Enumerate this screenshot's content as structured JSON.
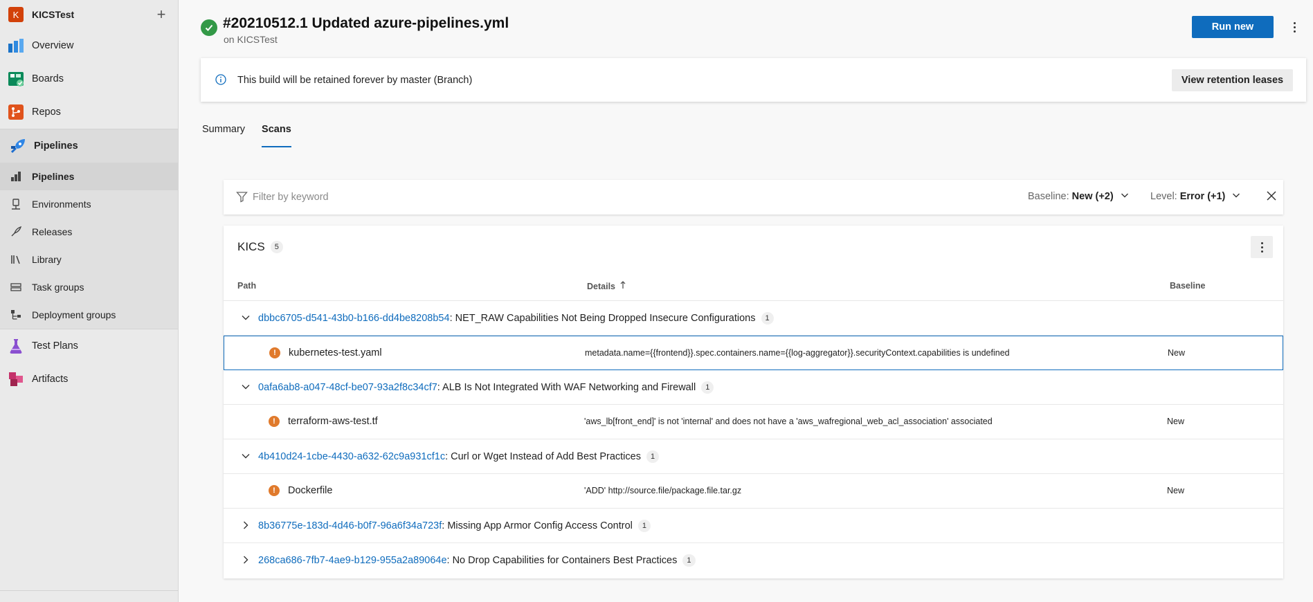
{
  "project": {
    "initial": "K",
    "name": "KICSTest"
  },
  "nav": {
    "overview": "Overview",
    "boards": "Boards",
    "repos": "Repos",
    "pipelines": "Pipelines",
    "sub": [
      "Pipelines",
      "Environments",
      "Releases",
      "Library",
      "Task groups",
      "Deployment groups"
    ],
    "test_plans": "Test Plans",
    "artifacts": "Artifacts"
  },
  "header": {
    "title": "#20210512.1 Updated azure-pipelines.yml",
    "subtitle": "on KICSTest",
    "run_new": "Run new"
  },
  "banner": {
    "text": "This build will be retained forever by master (Branch)",
    "button": "View retention leases"
  },
  "tabs": {
    "summary": "Summary",
    "scans": "Scans"
  },
  "filter": {
    "placeholder": "Filter by keyword",
    "baseline_label": "Baseline:",
    "baseline_value": "New (+2)",
    "level_label": "Level:",
    "level_value": "Error (+1)"
  },
  "results": {
    "tool": "KICS",
    "count": "5",
    "columns": {
      "path": "Path",
      "details": "Details",
      "baseline": "Baseline"
    },
    "groups": [
      {
        "id": "dbbc6705-d541-43b0-b166-dd4be8208b54",
        "title": ": NET_RAW Capabilities Not Being Dropped Insecure Configurations",
        "count": "1",
        "expanded": true,
        "finding": {
          "file": "kubernetes-test.yaml",
          "detail": "metadata.name={{frontend}}.spec.containers.name={{log-aggregator}}.securityContext.capabilities is undefined",
          "baseline": "New"
        }
      },
      {
        "id": "0afa6ab8-a047-48cf-be07-93a2f8c34cf7",
        "title": ": ALB Is Not Integrated With WAF Networking and Firewall",
        "count": "1",
        "expanded": true,
        "finding": {
          "file": "terraform-aws-test.tf",
          "detail": "'aws_lb[front_end]' is not 'internal' and does not have a 'aws_wafregional_web_acl_association' associated",
          "baseline": "New"
        }
      },
      {
        "id": "4b410d24-1cbe-4430-a632-62c9a931cf1c",
        "title": ": Curl or Wget Instead of Add Best Practices",
        "count": "1",
        "expanded": true,
        "finding": {
          "file": "Dockerfile",
          "detail": "'ADD' http://source.file/package.file.tar.gz",
          "baseline": "New"
        }
      },
      {
        "id": "8b36775e-183d-4d46-b0f7-96a6f34a723f",
        "title": ": Missing App Armor Config Access Control",
        "count": "1",
        "expanded": false
      },
      {
        "id": "268ca686-7fb7-4ae9-b129-955a2a89064e",
        "title": ": No Drop Capabilities for Containers Best Practices",
        "count": "1",
        "expanded": false
      }
    ]
  },
  "colors": {
    "accent": "#0f6cbd",
    "success": "#339947",
    "warning": "#e07a2c",
    "project": "#d2410a"
  }
}
